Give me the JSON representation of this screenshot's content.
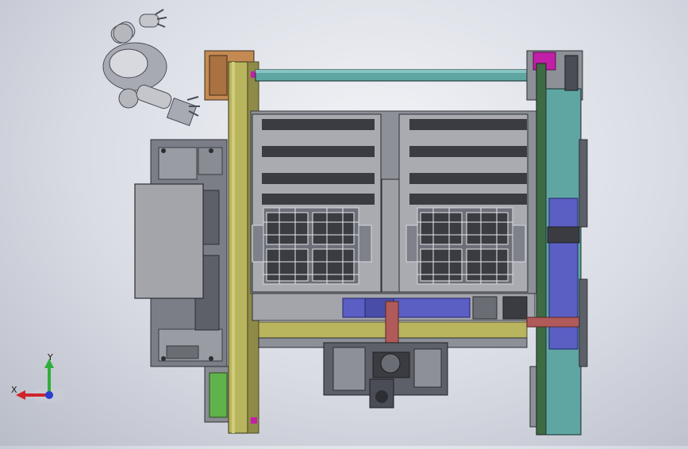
{
  "view": {
    "colors": {
      "frame_olive": "#b9b45e",
      "frame_dark": "#6f6d3a",
      "teal": "#5fa6a3",
      "blue": "#5b5fc4",
      "grey_plate": "#8d9097",
      "dark_steel": "#4a4d55",
      "magenta": "#c21fa8",
      "orange": "#c48a52",
      "green": "#5fb34a",
      "red_band": "#b05a5a"
    },
    "icons": [
      "robot-arm-icon",
      "coordinate-triad-icon"
    ]
  },
  "triad": {
    "y_label": "Y",
    "x_label": "X",
    "colors": {
      "y": "#2fae3a",
      "x": "#d0232a",
      "z": "#2a3fd0"
    }
  }
}
